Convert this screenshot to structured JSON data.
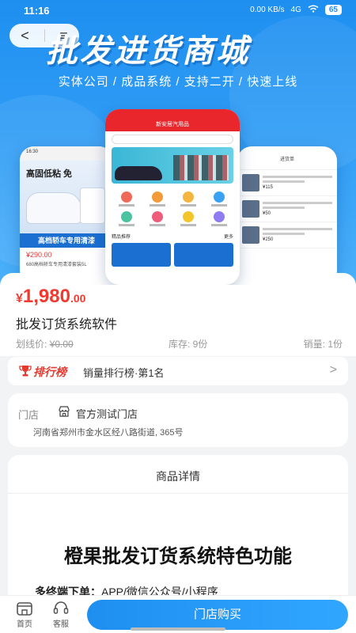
{
  "status_bar": {
    "time": "11:16",
    "speed": "0.00 KB/s",
    "network": "4G",
    "battery": "65"
  },
  "nav": {
    "back_label": "<",
    "menu_label": "≡"
  },
  "banner": {
    "title": "批发进货商城",
    "subtitle": "实体公司 / 成品系统 / 支持二开 / 快速上线",
    "left_phone": {
      "time": "16:30",
      "headline": "高固低粘 免",
      "band": "高档轿车专用清漆",
      "price": "¥290.00",
      "desc": "680高档轿车专用清漆套装5L"
    },
    "center_phone": {
      "store": "新安居汽用品",
      "section": "精品推荐",
      "more": "更多"
    },
    "right_phone": {
      "header": "进货单",
      "prices": [
        "¥115",
        "¥50",
        "¥250"
      ]
    }
  },
  "product": {
    "currency": "¥",
    "price_int": "1,980",
    "price_dec": ".00",
    "name": "批发订货系统软件",
    "original_label": "划线价:",
    "original_value": "¥0.00",
    "stock": "库存: 9份",
    "sales": "销量: 1份"
  },
  "ranking": {
    "brand": "排行榜",
    "text": "销量排行榜·第1名",
    "chevron": ">"
  },
  "store": {
    "label": "门店",
    "name": "官方测试门店",
    "address": "河南省郑州市金水区经八路街道, 365号"
  },
  "detail": {
    "section_title": "商品详情",
    "heading": "橙果批发订货系统特色功能",
    "line_label": "多终端下单：",
    "line_text": "APP/微信公众号/小程序"
  },
  "bottom_bar": {
    "home_label": "首页",
    "service_label": "客服",
    "buy_label": "门店购买"
  },
  "colors": {
    "accent": "#1e8ff0",
    "price": "#f03a30",
    "rank": "#e53a2f"
  }
}
